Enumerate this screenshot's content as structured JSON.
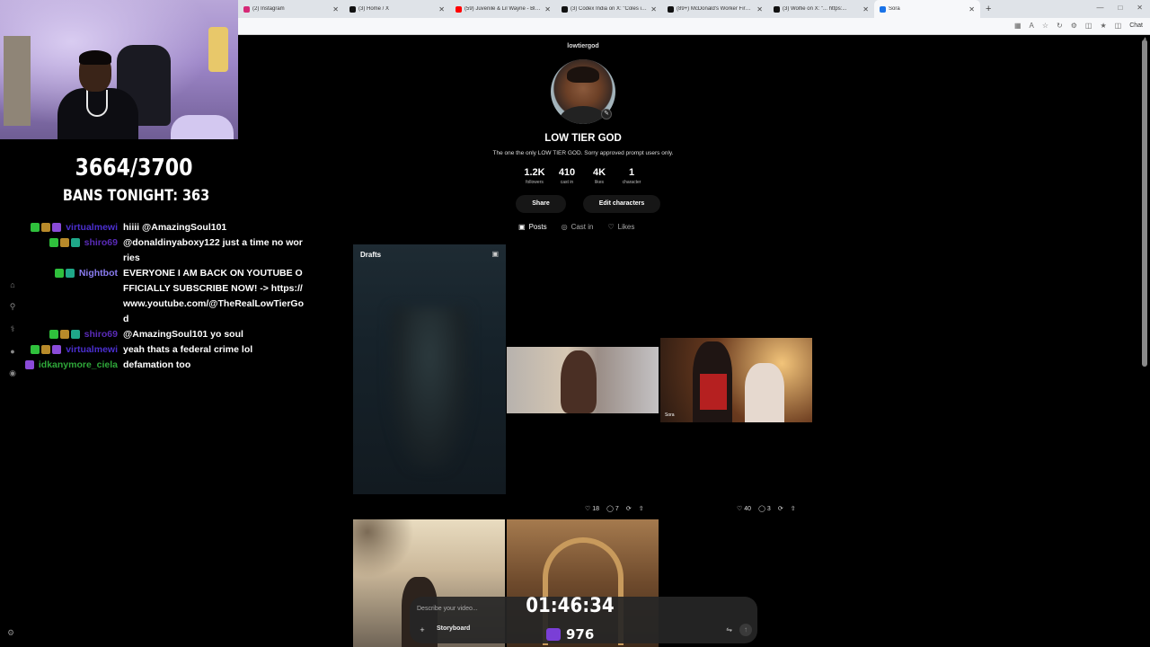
{
  "browser": {
    "tabs": [
      {
        "title": "(2) Instagram",
        "color": "#d62976"
      },
      {
        "title": "(3) Home / X",
        "color": "#111111"
      },
      {
        "title": "(59) Juvenile & Lil Wayne - Bling B...",
        "color": "#ff0000"
      },
      {
        "title": "(3) Codex India on X: \"Coles inform...",
        "color": "#111111"
      },
      {
        "title": "(89+) McDonald's Worker Fired Aft...",
        "color": "#111111"
      },
      {
        "title": "(3) Wolfie on X: \"... https:...",
        "color": "#111111"
      },
      {
        "title": "Sora",
        "color": "#1a73e8"
      }
    ],
    "new_tab": "+",
    "chat_label": "Chat"
  },
  "overlay": {
    "counter": "3664/3700",
    "bans_label": "BANS TONIGHT: 363",
    "timer": "01:46:34",
    "sub_count": "976"
  },
  "chat": [
    {
      "user": "virtualmewi",
      "color": "#4b2fd0",
      "badges": [
        "b-green",
        "b-gold",
        "b-purple"
      ],
      "text": "hiiii @AmazingSoul101"
    },
    {
      "user": "shiro69",
      "color": "#5a2bb8",
      "badges": [
        "b-green",
        "b-gold",
        "b-teal"
      ],
      "text": "@donaldinyaboxy122 just a time no worries"
    },
    {
      "user": "Nightbot",
      "color": "#8a7cf0",
      "badges": [
        "b-green",
        "b-teal"
      ],
      "text": "EVERYONE I AM BACK ON YOUTUBE OFFICIALLY SUBSCRIBE NOW! -> https://www.youtube.com/@TheRealLowTierGod"
    },
    {
      "user": "shiro69",
      "color": "#5a2bb8",
      "badges": [
        "b-green",
        "b-gold",
        "b-teal"
      ],
      "text": "@AmazingSoul101 yo soul"
    },
    {
      "user": "virtualmewi",
      "color": "#4b2fd0",
      "badges": [
        "b-green",
        "b-gold",
        "b-purple"
      ],
      "text": "yeah thats a federal crime lol"
    },
    {
      "user": "idkanymore_ciela",
      "color": "#2fa83a",
      "badges": [
        "b-purple"
      ],
      "text": "defamation too"
    }
  ],
  "profile": {
    "handle": "lowtiergod",
    "name": "LOW TIER GOD",
    "bio": "The one the only LOW TIER GOD. Sorry approved prompt users only.",
    "stats": [
      {
        "num": "1.2K",
        "lbl": "followers"
      },
      {
        "num": "410",
        "lbl": "cast in"
      },
      {
        "num": "4K",
        "lbl": "likes"
      },
      {
        "num": "1",
        "lbl": "character"
      }
    ],
    "share_label": "Share",
    "edit_label": "Edit characters",
    "tabs": [
      {
        "label": "Posts",
        "icon": "▣"
      },
      {
        "label": "Cast in",
        "icon": "◎"
      },
      {
        "label": "Likes",
        "icon": "♡"
      }
    ]
  },
  "grid": {
    "drafts_label": "Drafts",
    "post1": {
      "likes": "18",
      "comments": "7"
    },
    "post2": {
      "likes": "40",
      "comments": "3"
    },
    "watermark": "Sora"
  },
  "prompt": {
    "placeholder": "Describe your video...",
    "storyboard_label": "Storyboard"
  }
}
